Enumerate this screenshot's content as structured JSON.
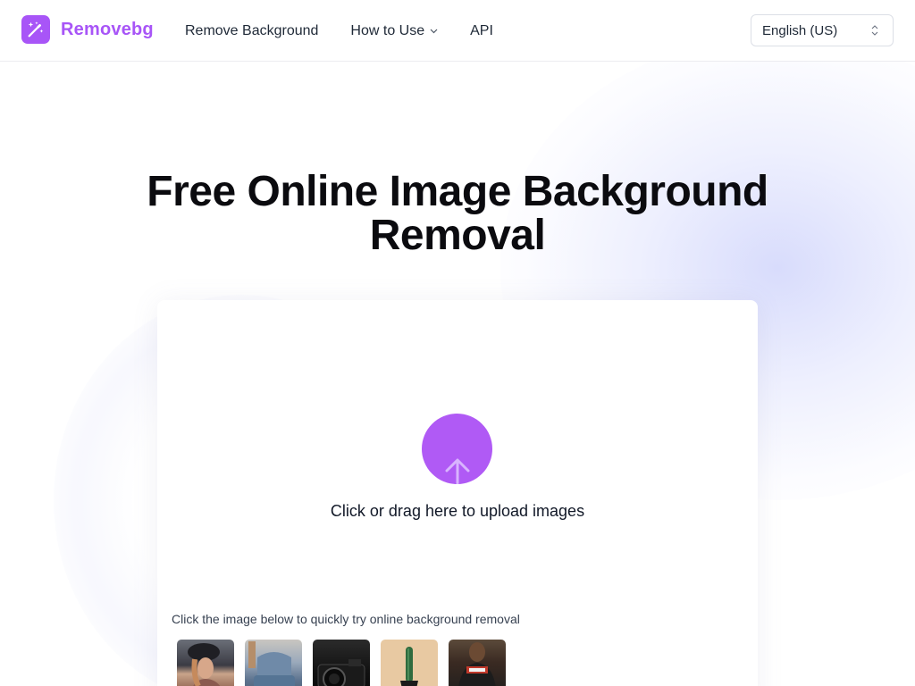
{
  "header": {
    "logo_text": "Removebg",
    "nav": [
      {
        "label": "Remove Background"
      },
      {
        "label": "How to Use"
      },
      {
        "label": "API"
      }
    ],
    "language": "English (US)"
  },
  "hero": {
    "title_line1": "Free Online Image Background",
    "title_line2": "Removal"
  },
  "upload": {
    "prompt": "Click or drag here to upload images",
    "try_text": "Click the image below to quickly try online background removal",
    "samples": [
      "sample-woman-hat",
      "sample-chair",
      "sample-camera",
      "sample-cactus",
      "sample-man"
    ]
  },
  "colors": {
    "brand": "#a855f7",
    "upload_circle": "#b05af5"
  }
}
